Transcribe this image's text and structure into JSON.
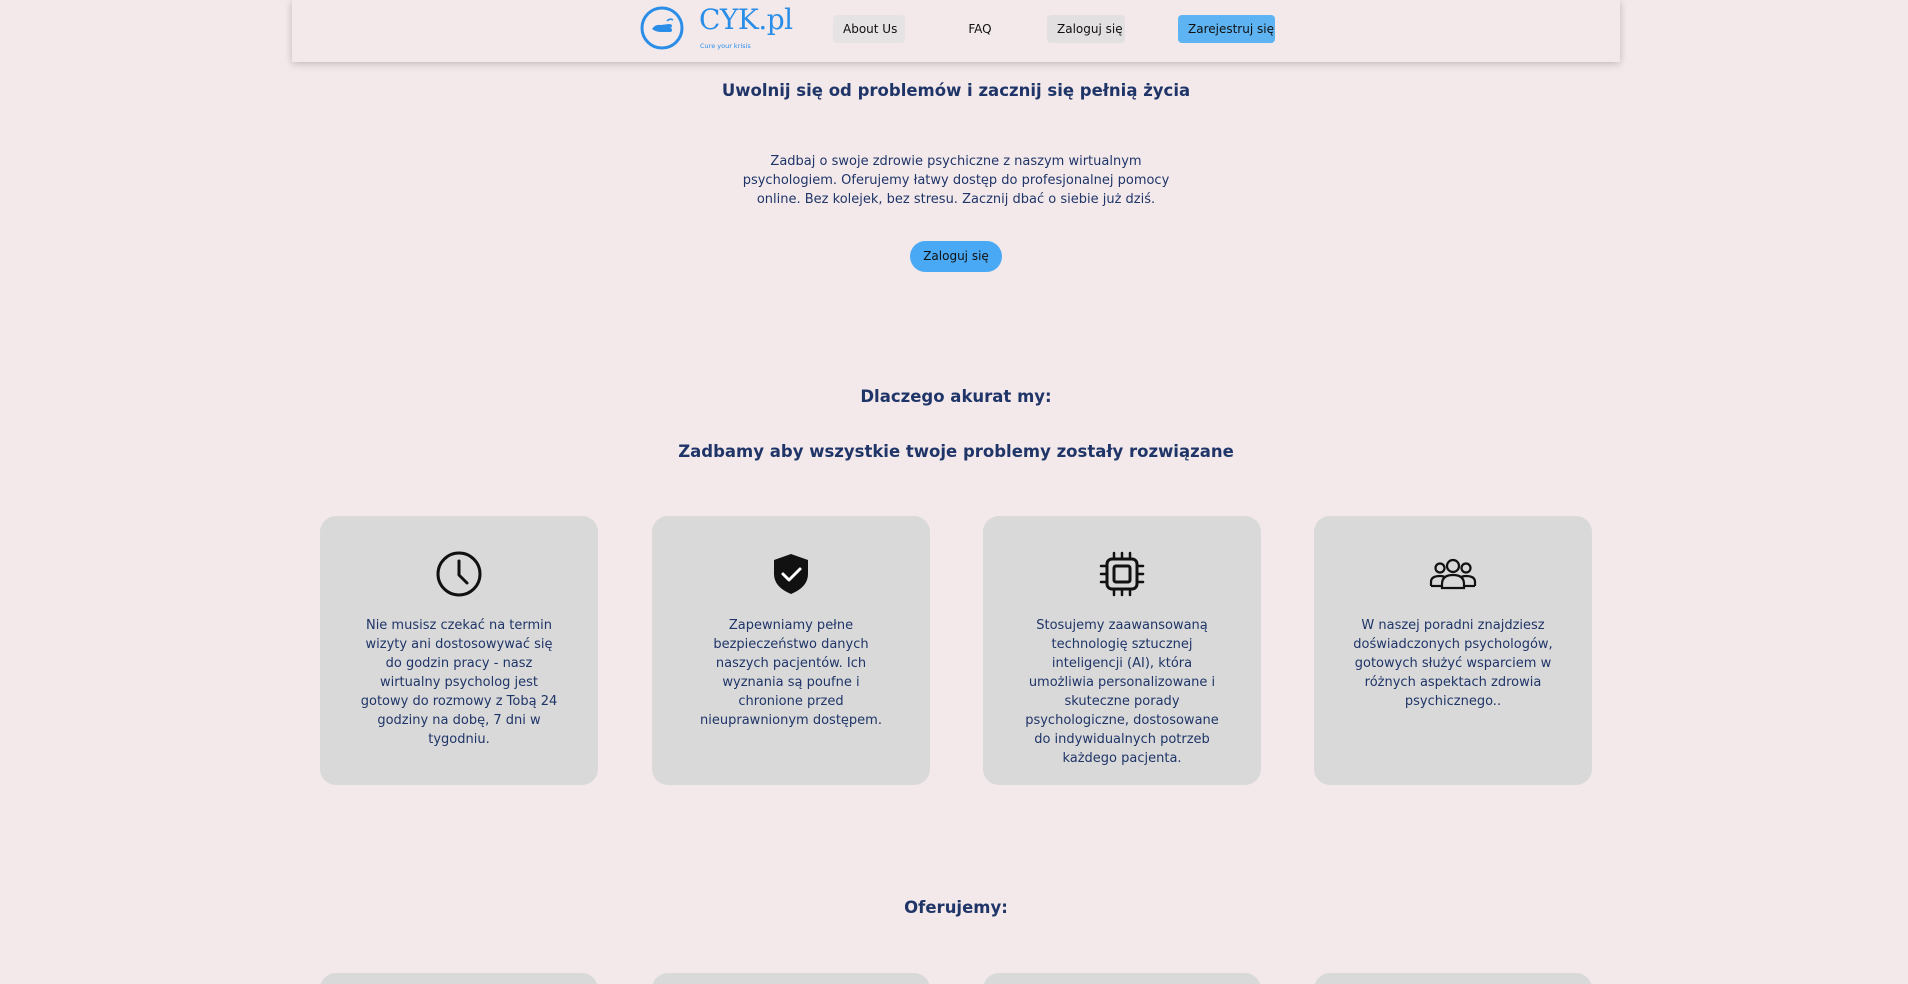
{
  "header": {
    "logo": {
      "title": "CYK.pl",
      "tagline": "Cure your krisis",
      "icon": "hand-circle-icon"
    },
    "nav": {
      "about_label": "About Us",
      "faq_label": "FAQ",
      "login_label": "Zaloguj się",
      "register_label": "Zarejestruj się"
    }
  },
  "hero": {
    "title": "Uwolnij się od problemów i zacznij się pełnią życia",
    "description": "Zadbaj o swoje zdrowie psychiczne z naszym wirtualnym psychologiem. Oferujemy łatwy dostęp do profesjonalnej pomocy online. Bez kolejek, bez stresu. Zacznij dbać o siebie już dziś.",
    "button_label": "Zaloguj się"
  },
  "why": {
    "title": "Dlaczego akurat my:",
    "subtitle": "Zadbamy aby wszystkie twoje problemy zostały rozwiązane",
    "cards": [
      {
        "icon": "clock-icon",
        "text": "Nie musisz czekać na termin wizyty ani dostosowywać się do godzin pracy - nasz wirtualny psycholog jest gotowy do rozmowy z Tobą 24 godziny na dobę, 7 dni w tygodniu."
      },
      {
        "icon": "shield-check-icon",
        "text": "Zapewniamy pełne bezpieczeństwo danych naszych pacjentów. Ich wyznania są poufne i chronione przed nieuprawnionym dostępem."
      },
      {
        "icon": "cpu-chip-icon",
        "text": "Stosujemy zaawansowaną technologię sztucznej inteligencji (AI), która umożliwia personalizowane i skuteczne porady psychologiczne, dostosowane do indywidualnych potrzeb każdego pacjenta."
      },
      {
        "icon": "people-group-icon",
        "text": "W naszej poradni znajdziesz doświadczonych psychologów, gotowych służyć wsparciem w różnych aspektach zdrowia psychicznego.."
      }
    ]
  },
  "offer": {
    "title": "Oferujemy:"
  },
  "colors": {
    "background": "#f3e9eb",
    "heading": "#1f3568",
    "accent": "#2a8ee8",
    "button": "#4aa9f4",
    "register_button": "#5eb3f2",
    "card": "#d9d9d9"
  }
}
